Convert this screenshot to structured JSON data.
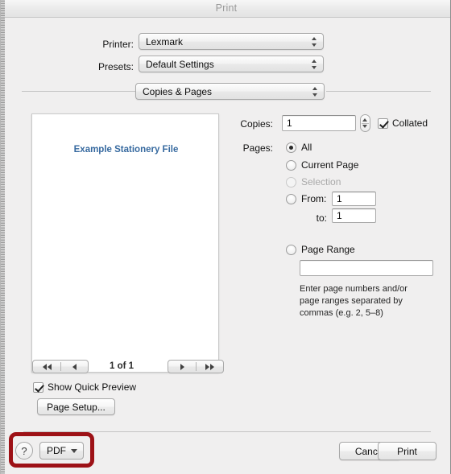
{
  "window": {
    "title": "Print"
  },
  "settings": {
    "printer_label": "Printer:",
    "printer_value": "Lexmark",
    "presets_label": "Presets:",
    "presets_value": "Default Settings",
    "pane_value": "Copies & Pages"
  },
  "copies": {
    "label": "Copies:",
    "value": "1",
    "collated_label": "Collated",
    "collated_checked": true
  },
  "pages": {
    "label": "Pages:",
    "options": [
      {
        "label": "All",
        "selected": true,
        "disabled": false
      },
      {
        "label": "Current Page",
        "selected": false,
        "disabled": false
      },
      {
        "label": "Selection",
        "selected": false,
        "disabled": true
      },
      {
        "label": "From:",
        "selected": false,
        "disabled": false
      }
    ],
    "from_value": "1",
    "to_label": "to:",
    "to_value": "1",
    "page_range_label": "Page Range",
    "page_range_selected": false,
    "page_range_value": "",
    "helper_text": "Enter page numbers and/or\npage ranges separated by\ncommas (e.g. 2, 5–8)"
  },
  "preview": {
    "document_text": "Example Stationery File",
    "page_indicator": "1 of 1",
    "first_icon": "first-page-icon",
    "previous_icon": "previous-page-icon",
    "next_icon": "next-page-icon",
    "last_icon": "last-page-icon",
    "quick_preview_label": "Show Quick Preview",
    "quick_preview_checked": true,
    "page_setup_label": "Page Setup..."
  },
  "footer": {
    "help_label": "?",
    "help_icon": "help-icon",
    "pdf_label": "PDF",
    "pdf_icon": "chevron-down-icon",
    "cancel_label": "Cancel",
    "print_label": "Print"
  },
  "annotation": {
    "color": "#9d1116"
  },
  "colors": {
    "window_bg": "#f0efef",
    "preview_text": "#36699f",
    "title_text": "#9a9a9a"
  }
}
